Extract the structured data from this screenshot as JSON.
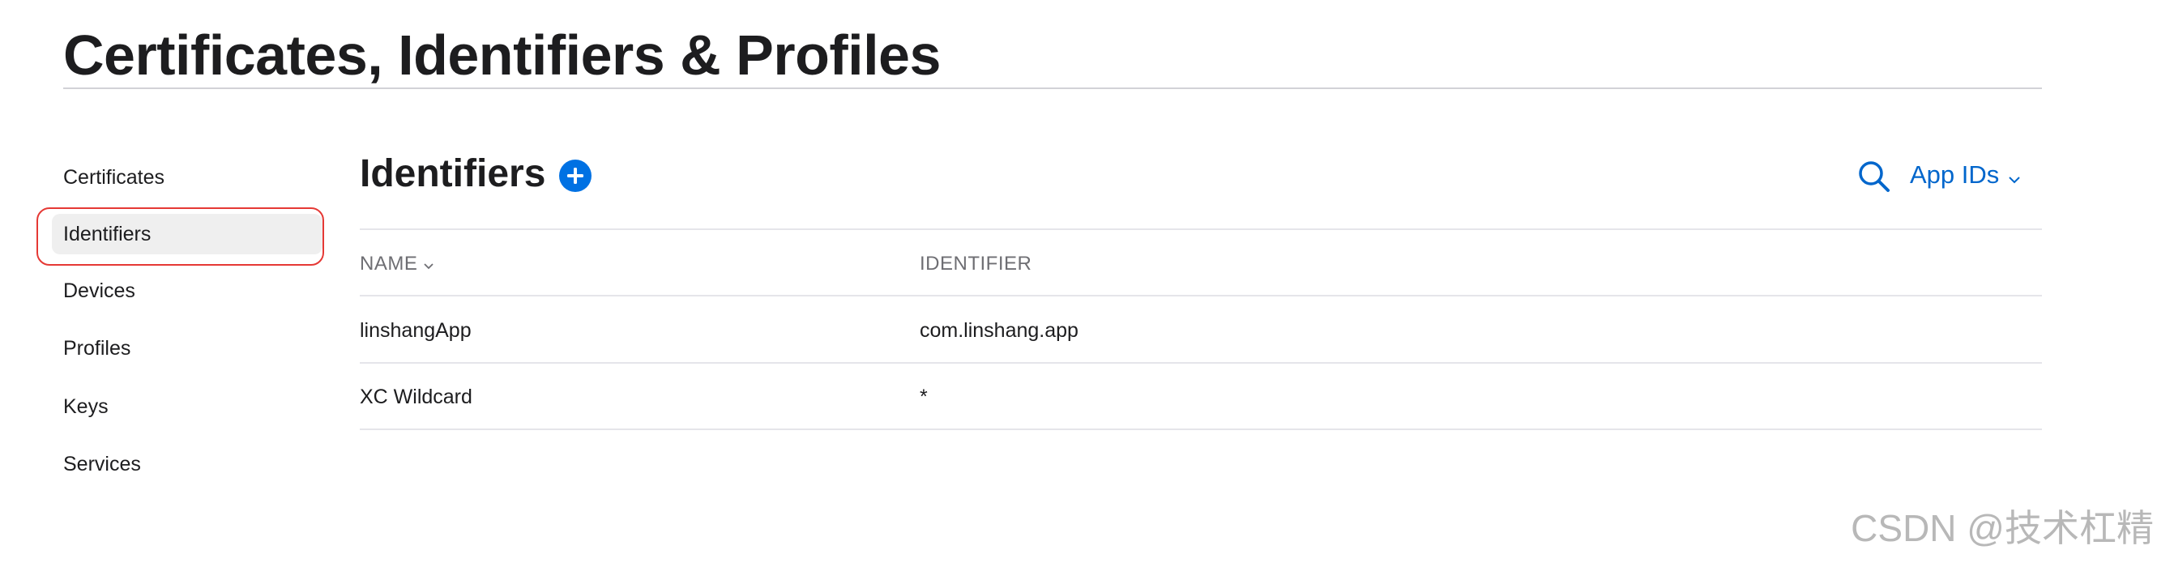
{
  "header": {
    "title": "Certificates, Identifiers & Profiles"
  },
  "sidebar": {
    "items": [
      {
        "label": "Certificates",
        "active": false
      },
      {
        "label": "Identifiers",
        "active": true
      },
      {
        "label": "Devices",
        "active": false
      },
      {
        "label": "Profiles",
        "active": false
      },
      {
        "label": "Keys",
        "active": false
      },
      {
        "label": "Services",
        "active": false
      }
    ]
  },
  "main": {
    "section_title": "Identifiers",
    "add_icon": "plus-circle-icon",
    "search_icon": "search-icon",
    "filter": {
      "selected": "App IDs",
      "icon": "chevron-down-icon"
    },
    "table": {
      "columns": [
        {
          "label": "NAME",
          "sortable": true
        },
        {
          "label": "IDENTIFIER",
          "sortable": false
        }
      ],
      "rows": [
        {
          "name": "linshangApp",
          "identifier": "com.linshang.app"
        },
        {
          "name": "XC Wildcard",
          "identifier": "*"
        }
      ]
    }
  },
  "watermark": "CSDN @技术杠精",
  "colors": {
    "accent": "#0071e3",
    "link": "#0066cc",
    "highlight_outline": "#e53935",
    "active_bg": "#efefef"
  }
}
